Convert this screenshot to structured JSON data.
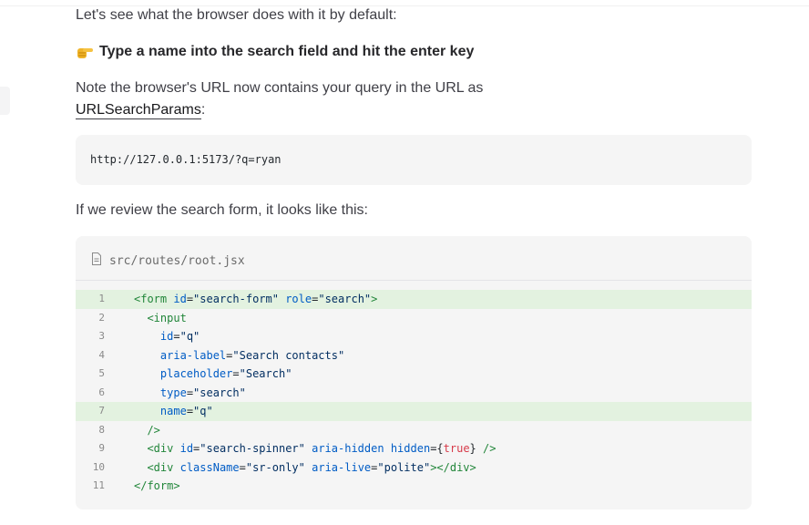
{
  "article": {
    "intro": "Let's see what the browser does with it by default:",
    "instruction": "Type a name into the search field and hit the enter key",
    "instruction_icon": "pointing-hand-icon",
    "note_text": "Note the browser's URL now contains your query in the URL as",
    "note_link": "URLSearchParams",
    "note_suffix": ":",
    "review_text": "If we review the search form, it looks like this:"
  },
  "url_block": {
    "code": "http://127.0.0.1:5173/?q=ryan"
  },
  "source_block": {
    "filename": "src/routes/root.jsx",
    "file_icon": "file-icon",
    "highlighted_lines": [
      1,
      7
    ],
    "line_numbers": [
      "1",
      "2",
      "3",
      "4",
      "5",
      "6",
      "7",
      "8",
      "9",
      "10",
      "11"
    ],
    "lines": [
      [
        {
          "t": "<form",
          "c": "tag"
        },
        {
          "t": " ",
          "c": "punct"
        },
        {
          "t": "id",
          "c": "attr"
        },
        {
          "t": "=",
          "c": "punct"
        },
        {
          "t": "\"search-form\"",
          "c": "str"
        },
        {
          "t": " ",
          "c": "punct"
        },
        {
          "t": "role",
          "c": "attr"
        },
        {
          "t": "=",
          "c": "punct"
        },
        {
          "t": "\"search\"",
          "c": "str"
        },
        {
          "t": ">",
          "c": "tag"
        }
      ],
      [
        {
          "t": "  ",
          "c": "punct"
        },
        {
          "t": "<input",
          "c": "tag"
        }
      ],
      [
        {
          "t": "    ",
          "c": "punct"
        },
        {
          "t": "id",
          "c": "attr"
        },
        {
          "t": "=",
          "c": "punct"
        },
        {
          "t": "\"q\"",
          "c": "str"
        }
      ],
      [
        {
          "t": "    ",
          "c": "punct"
        },
        {
          "t": "aria-label",
          "c": "attr"
        },
        {
          "t": "=",
          "c": "punct"
        },
        {
          "t": "\"Search contacts\"",
          "c": "str"
        }
      ],
      [
        {
          "t": "    ",
          "c": "punct"
        },
        {
          "t": "placeholder",
          "c": "attr"
        },
        {
          "t": "=",
          "c": "punct"
        },
        {
          "t": "\"Search\"",
          "c": "str"
        }
      ],
      [
        {
          "t": "    ",
          "c": "punct"
        },
        {
          "t": "type",
          "c": "attr"
        },
        {
          "t": "=",
          "c": "punct"
        },
        {
          "t": "\"search\"",
          "c": "str"
        }
      ],
      [
        {
          "t": "    ",
          "c": "punct"
        },
        {
          "t": "name",
          "c": "attr"
        },
        {
          "t": "=",
          "c": "punct"
        },
        {
          "t": "\"q\"",
          "c": "str"
        }
      ],
      [
        {
          "t": "  ",
          "c": "punct"
        },
        {
          "t": "/>",
          "c": "tag"
        }
      ],
      [
        {
          "t": "  ",
          "c": "punct"
        },
        {
          "t": "<div",
          "c": "tag"
        },
        {
          "t": " ",
          "c": "punct"
        },
        {
          "t": "id",
          "c": "attr"
        },
        {
          "t": "=",
          "c": "punct"
        },
        {
          "t": "\"search-spinner\"",
          "c": "str"
        },
        {
          "t": " ",
          "c": "punct"
        },
        {
          "t": "aria-hidden",
          "c": "attr"
        },
        {
          "t": " ",
          "c": "punct"
        },
        {
          "t": "hidden",
          "c": "attr"
        },
        {
          "t": "={",
          "c": "punct"
        },
        {
          "t": "true",
          "c": "kw"
        },
        {
          "t": "}",
          "c": "punct"
        },
        {
          "t": " ",
          "c": "punct"
        },
        {
          "t": "/>",
          "c": "tag"
        }
      ],
      [
        {
          "t": "  ",
          "c": "punct"
        },
        {
          "t": "<div",
          "c": "tag"
        },
        {
          "t": " ",
          "c": "punct"
        },
        {
          "t": "className",
          "c": "attr"
        },
        {
          "t": "=",
          "c": "punct"
        },
        {
          "t": "\"sr-only\"",
          "c": "str"
        },
        {
          "t": " ",
          "c": "punct"
        },
        {
          "t": "aria-live",
          "c": "attr"
        },
        {
          "t": "=",
          "c": "punct"
        },
        {
          "t": "\"polite\"",
          "c": "str"
        },
        {
          "t": "></div>",
          "c": "tag"
        }
      ],
      [
        {
          "t": "</form>",
          "c": "tag"
        }
      ]
    ]
  },
  "colors": {
    "highlight_bg": "#e3f2e0",
    "code_bg": "#f5f5f5",
    "tag": "#22863a",
    "attr": "#005cc5",
    "string": "#032f62",
    "keyword": "#d73a49"
  }
}
